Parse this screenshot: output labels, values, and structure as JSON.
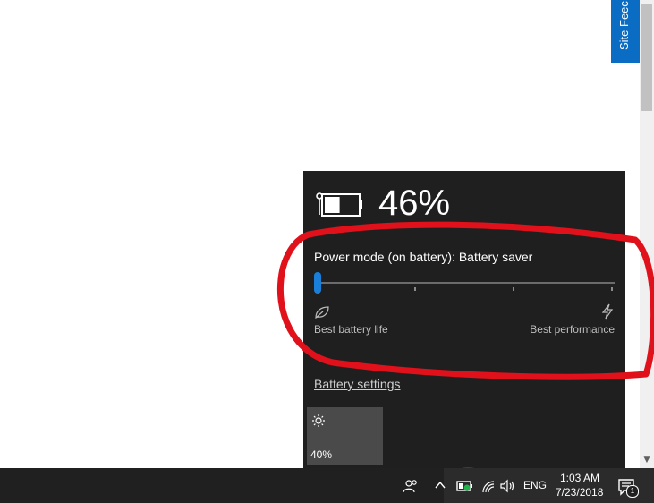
{
  "site_feedback": {
    "label": "Site Feec"
  },
  "battery": {
    "percent_text": "46%",
    "level": 0.46,
    "power_mode_label": "Power mode (on battery): Battery saver",
    "slider_position": 0,
    "left_label": "Best battery life",
    "right_label": "Best performance",
    "settings_link": "Battery settings"
  },
  "quick_action": {
    "brightness_value": "40%",
    "icon": "sun-icon"
  },
  "taskbar": {
    "language": "ENG",
    "time": "1:03 AM",
    "date": "7/23/2018",
    "notification_count": "1"
  },
  "colors": {
    "accent": "#1a7fd8",
    "annotation": "#e0111a",
    "flyout_bg": "#1f1f1f",
    "feedback_bg": "#0a6cc2"
  }
}
